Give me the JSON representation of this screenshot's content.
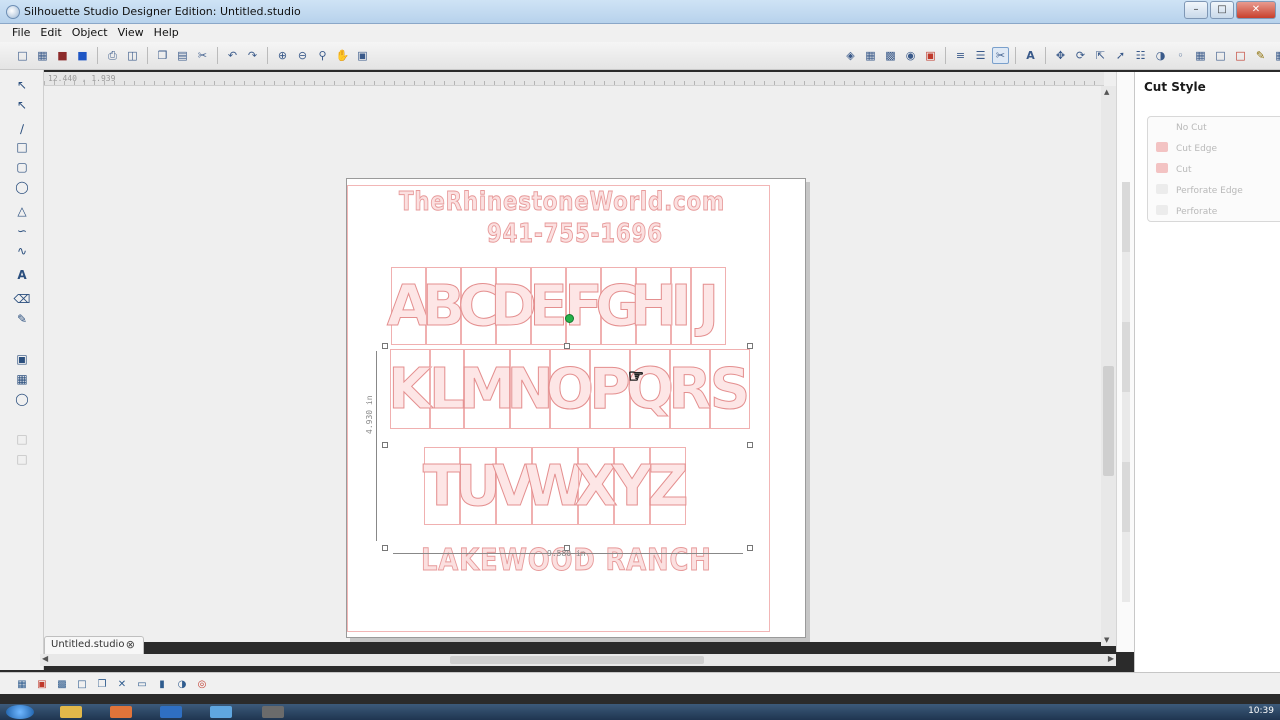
{
  "window": {
    "title": "Silhouette Studio Designer Edition: Untitled.studio"
  },
  "menu": [
    "File",
    "Edit",
    "Object",
    "View",
    "Help"
  ],
  "ruler": {
    "coords": "12.440 , 1.939"
  },
  "document_tab": {
    "label": "Untitled.studio"
  },
  "design": {
    "website": "TheRhinestoneWorld.com",
    "phone": "941-755-1696",
    "row1": [
      "A",
      "B",
      "C",
      "D",
      "E",
      "F",
      "G",
      "H",
      "I",
      "J"
    ],
    "row2": [
      "K",
      "L",
      "M",
      "N",
      "O",
      "P",
      "Q",
      "R",
      "S"
    ],
    "row3": [
      "T",
      "U",
      "V",
      "W",
      "X",
      "Y",
      "Z"
    ],
    "footer": "LAKEWOOD RANCH",
    "height_dim": "4.930 in",
    "width_dim": "9.580 in"
  },
  "cut_style": {
    "title": "Cut Style",
    "options": [
      "No Cut",
      "Cut Edge",
      "Cut",
      "Perforate Edge",
      "Perforate"
    ]
  },
  "clock": {
    "time": "10:39"
  },
  "colors": {
    "cut_line": "#e79a9a",
    "accent": "#2b4f7e",
    "titlebar": "#b7d2ec"
  }
}
